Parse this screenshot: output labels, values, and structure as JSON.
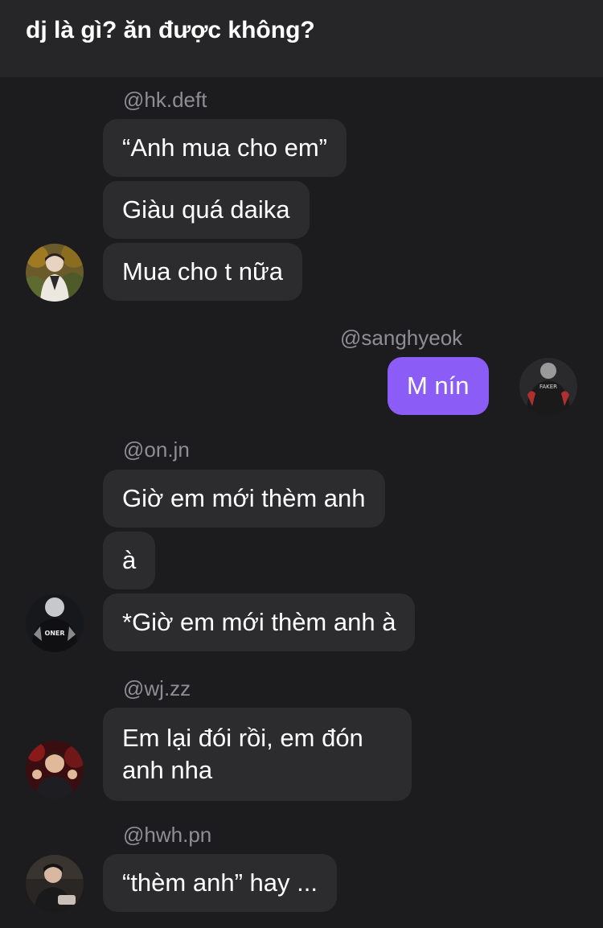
{
  "header": {
    "title": "dj là gì? ăn được không?"
  },
  "messages": [
    {
      "username": "@hk.deft",
      "avatar_icon": "person-avatar-icon",
      "bubbles": [
        "“Anh mua cho em”",
        "Giàu quá daika",
        "Mua cho t nữa"
      ]
    },
    {
      "username": "@sanghyeok",
      "avatar_icon": "person-avatar-icon",
      "avatar_text": "FAKER",
      "bubbles": [
        "M nín"
      ]
    },
    {
      "username": "@on.jn",
      "avatar_icon": "person-avatar-icon",
      "avatar_text": "ONER",
      "bubbles": [
        "Giờ em mới thèm anh",
        "à",
        "*Giờ em mới thèm anh à"
      ]
    },
    {
      "username": "@wj.zz",
      "avatar_icon": "person-avatar-icon",
      "bubbles": [
        "Em lại đói rồi, em đón anh nha"
      ]
    },
    {
      "username": "@hwh.pn",
      "avatar_icon": "person-avatar-icon",
      "bubbles": [
        "“thèm anh” hay ..."
      ]
    }
  ],
  "colors": {
    "background": "#1c1c1e",
    "header": "#262628",
    "bubble": "#2c2c2e",
    "own_bubble": "#8b5cf6",
    "username": "#8e8e93"
  }
}
